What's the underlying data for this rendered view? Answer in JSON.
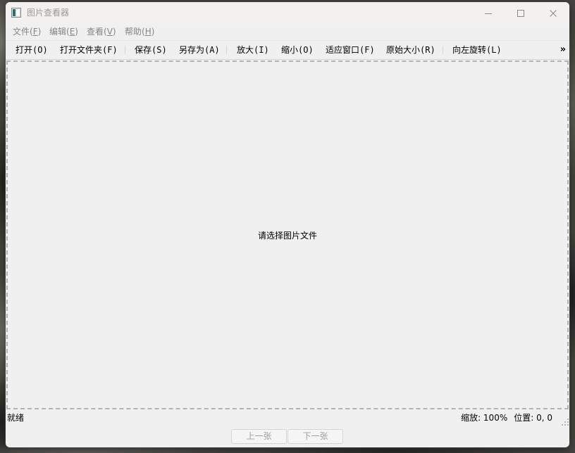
{
  "window": {
    "title": "图片查看器",
    "icons": {
      "app": "image-viewer-app-icon",
      "minimize": "minimize-icon",
      "maximize": "maximize-icon",
      "close": "close-icon"
    }
  },
  "menu": {
    "items": [
      {
        "label": "文件(F)"
      },
      {
        "label": "编辑(E)"
      },
      {
        "label": "查看(V)"
      },
      {
        "label": "帮助(H)"
      }
    ]
  },
  "toolbar": {
    "items": [
      {
        "label": "打开(O)"
      },
      {
        "label": "打开文件夹(F)"
      },
      {
        "label": "保存(S)"
      },
      {
        "label": "另存为(A)"
      },
      {
        "label": "放大(I)"
      },
      {
        "label": "缩小(O)"
      },
      {
        "label": "适应窗口(F)"
      },
      {
        "label": "原始大小(R)"
      },
      {
        "label": "向左旋转(L)"
      }
    ],
    "overflow_label": "»"
  },
  "viewer": {
    "placeholder": "请选择图片文件"
  },
  "status_bar": {
    "message": "就绪",
    "zoom": "缩放: 100%",
    "position": "位置: 0, 0",
    "size_grip_icon": "size-grip-icon"
  },
  "navigation": {
    "prev_label": "上一张",
    "next_label": "下一张",
    "disabled": true
  },
  "theme": {
    "window_bg": "#f0f0f0",
    "titlebar_bg": "#f4f0f0",
    "viewer_border": "#b3b3b3",
    "disabled_text": "#9f9f9f"
  }
}
